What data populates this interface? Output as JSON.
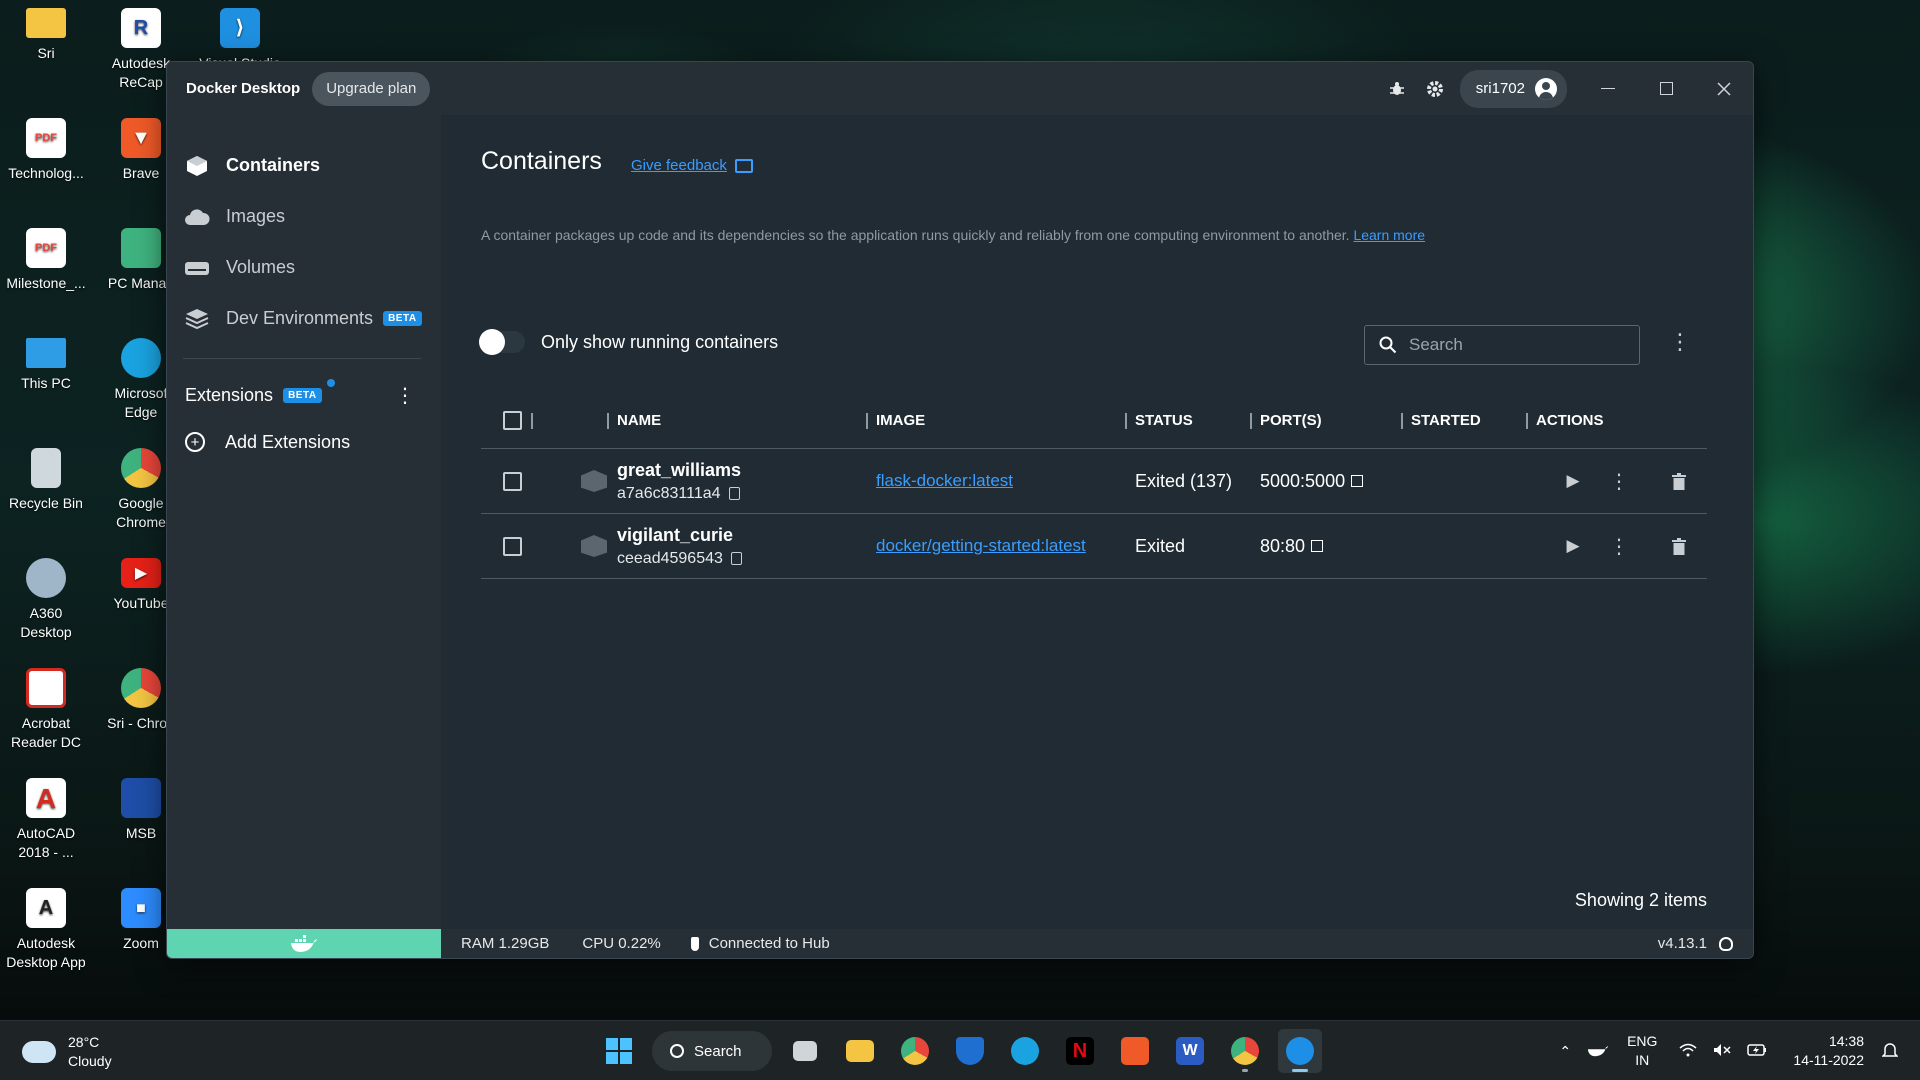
{
  "desktop": {
    "icons": [
      {
        "label": "Sri",
        "label2": "",
        "icon": "folder-icon",
        "color": "#f4c542"
      },
      {
        "label": "Autodesk",
        "label2": "ReCap",
        "icon": "autodesk-recap-icon",
        "color": "#ffffff"
      },
      {
        "label": "Visual Studio",
        "label2": "",
        "icon": "vscode-icon",
        "color": "#1f8fe0"
      },
      {
        "label": "Technolog...",
        "label2": "",
        "icon": "pdf-icon",
        "color": "#e8463a"
      },
      {
        "label": "Brave",
        "label2": "",
        "icon": "brave-icon",
        "color": "#f05a28"
      },
      {
        "label": "Milestone_...",
        "label2": "",
        "icon": "pdf-icon",
        "color": "#e8463a"
      },
      {
        "label": "PC Manag",
        "label2": "",
        "icon": "pc-manager-icon",
        "color": "#3fb37f"
      },
      {
        "label": "This PC",
        "label2": "",
        "icon": "monitor-icon",
        "color": "#2f9ce6"
      },
      {
        "label": "Microsof",
        "label2": "Edge",
        "icon": "edge-icon",
        "color": "#1aa3e0"
      },
      {
        "label": "Recycle Bin",
        "label2": "",
        "icon": "recycle-bin-icon",
        "color": "#cfd8dc"
      },
      {
        "label": "Google",
        "label2": "Chrome",
        "icon": "chrome-icon",
        "color": "#e8463a"
      },
      {
        "label": "A360",
        "label2": "Desktop",
        "icon": "a360-icon",
        "color": "#9fb6c8"
      },
      {
        "label": "YouTube",
        "label2": "",
        "icon": "youtube-icon",
        "color": "#e62117"
      },
      {
        "label": "Acrobat",
        "label2": "Reader DC",
        "icon": "acrobat-icon",
        "color": "#d42a1f"
      },
      {
        "label": "Sri - Chron",
        "label2": "",
        "icon": "chrome-icon",
        "color": "#e8463a"
      },
      {
        "label": "AutoCAD",
        "label2": "2018 - ...",
        "icon": "autocad-icon",
        "color": "#d42a1f"
      },
      {
        "label": "MSB",
        "label2": "",
        "icon": "msb-icon",
        "color": "#1e4ea8"
      },
      {
        "label": "Autodesk",
        "label2": "Desktop App",
        "icon": "autodesk-app-icon",
        "color": "#ffffff"
      },
      {
        "label": "Zoom",
        "label2": "",
        "icon": "zoom-icon",
        "color": "#2d8cff"
      }
    ]
  },
  "window": {
    "app_title": "Docker Desktop",
    "upgrade_label": "Upgrade plan",
    "username": "sri1702"
  },
  "sidebar": {
    "items": [
      {
        "label": "Containers",
        "icon": "containers-icon"
      },
      {
        "label": "Images",
        "icon": "cloud-icon"
      },
      {
        "label": "Volumes",
        "icon": "volume-icon"
      },
      {
        "label": "Dev Environments",
        "icon": "dev-env-icon",
        "badge": "BETA"
      }
    ],
    "extensions_label": "Extensions",
    "extensions_badge": "BETA",
    "add_extensions_label": "Add Extensions"
  },
  "main": {
    "title": "Containers",
    "feedback_label": "Give feedback",
    "description": "A container packages up code and its dependencies so the application runs quickly and reliably from one computing environment to another.",
    "learn_more": "Learn more",
    "toggle_label": "Only show running containers",
    "search_placeholder": "Search",
    "columns": [
      "NAME",
      "IMAGE",
      "STATUS",
      "PORT(S)",
      "STARTED",
      "ACTIONS"
    ],
    "rows": [
      {
        "name": "great_williams",
        "id": "a7a6c83111a4",
        "image": "flask-docker:latest",
        "status": "Exited (137)",
        "ports": "5000:5000",
        "started": ""
      },
      {
        "name": "vigilant_curie",
        "id": "ceead4596543",
        "image": "docker/getting-started:latest",
        "status": "Exited",
        "ports": "80:80",
        "started": ""
      }
    ],
    "showing": "Showing 2 items"
  },
  "statusbar": {
    "ram": "RAM 1.29GB",
    "cpu": "CPU 0.22%",
    "hub": "Connected to Hub",
    "version": "v4.13.1"
  },
  "taskbar": {
    "temperature": "28°C",
    "weather": "Cloudy",
    "search_label": "Search",
    "lang_line1": "ENG",
    "lang_line2": "IN",
    "time": "14:38",
    "date": "14-11-2022"
  },
  "colors": {
    "accent": "#1d8fe6",
    "link": "#3a9dff",
    "docker_green": "#5fd4b0",
    "window_bg": "#202b33",
    "sidebar_bg": "#262f36"
  }
}
